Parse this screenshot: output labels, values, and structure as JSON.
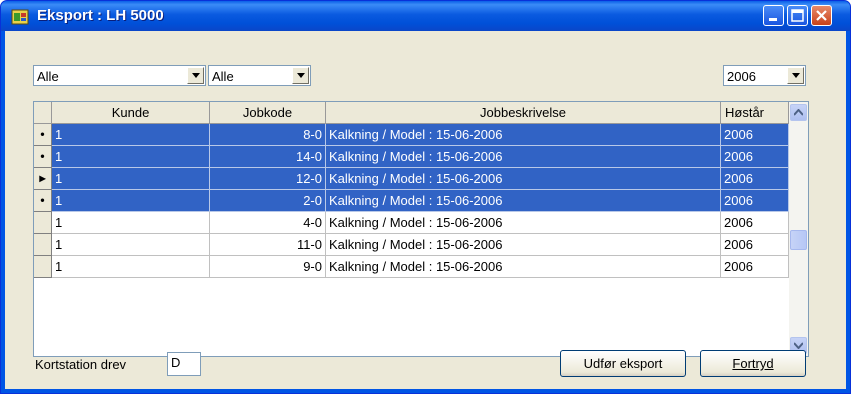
{
  "window": {
    "title": "Eksport : LH 5000"
  },
  "filters": {
    "filter1_value": "Alle",
    "filter2_value": "Alle",
    "year_value": "2006"
  },
  "table": {
    "columns": [
      "Kunde",
      "Jobkode",
      "Jobbeskrivelse",
      "Høstår"
    ],
    "rows": [
      {
        "indicator": "•",
        "kunde": "1",
        "jobkode": "8-0",
        "beskrivelse": "Kalkning / Model : 15-06-2006",
        "aar": "2006",
        "selected": true
      },
      {
        "indicator": "•",
        "kunde": "1",
        "jobkode": "14-0",
        "beskrivelse": "Kalkning / Model : 15-06-2006",
        "aar": "2006",
        "selected": true
      },
      {
        "indicator": "▸",
        "kunde": "1",
        "jobkode": "12-0",
        "beskrivelse": "Kalkning / Model : 15-06-2006",
        "aar": "2006",
        "selected": true
      },
      {
        "indicator": "•",
        "kunde": "1",
        "jobkode": "2-0",
        "beskrivelse": "Kalkning / Model : 15-06-2006",
        "aar": "2006",
        "selected": true
      },
      {
        "indicator": "",
        "kunde": "1",
        "jobkode": "4-0",
        "beskrivelse": "Kalkning / Model : 15-06-2006",
        "aar": "2006",
        "selected": false
      },
      {
        "indicator": "",
        "kunde": "1",
        "jobkode": "11-0",
        "beskrivelse": "Kalkning / Model : 15-06-2006",
        "aar": "2006",
        "selected": false
      },
      {
        "indicator": "",
        "kunde": "1",
        "jobkode": "9-0",
        "beskrivelse": "Kalkning / Model : 15-06-2006",
        "aar": "2006",
        "selected": false
      }
    ]
  },
  "footer": {
    "drive_label": "Kortstation drev",
    "drive_value": "D",
    "export_button": "Udfør eksport",
    "cancel_button": "Fortryd"
  },
  "colors": {
    "titlebar": "#0055e5",
    "selection": "#3163c5",
    "client_bg": "#ece9d8"
  }
}
